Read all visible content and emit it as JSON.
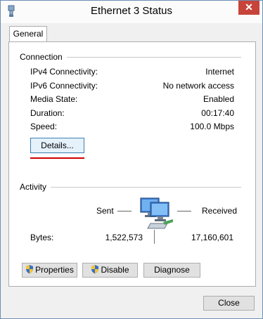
{
  "window": {
    "title": "Ethernet 3 Status"
  },
  "tabs": [
    {
      "label": "General"
    }
  ],
  "connection": {
    "group_label": "Connection",
    "rows": [
      {
        "label": "IPv4 Connectivity:",
        "value": "Internet"
      },
      {
        "label": "IPv6 Connectivity:",
        "value": "No network access"
      },
      {
        "label": "Media State:",
        "value": "Enabled"
      },
      {
        "label": "Duration:",
        "value": "00:17:40"
      },
      {
        "label": "Speed:",
        "value": "100.0 Mbps"
      }
    ],
    "details_label": "Details..."
  },
  "activity": {
    "group_label": "Activity",
    "sent_label": "Sent",
    "received_label": "Received",
    "bytes_label": "Bytes:",
    "bytes_sent": "1,522,573",
    "bytes_received": "17,160,601"
  },
  "buttons": {
    "properties": "Properties",
    "disable": "Disable",
    "diagnose": "Diagnose",
    "close": "Close"
  },
  "icons": {
    "title": "network-adapter-icon",
    "close": "close-icon",
    "properties": "shield-icon",
    "disable": "shield-icon",
    "activity": "network-computers-icon"
  },
  "colors": {
    "close_button": "#c7443b",
    "highlight_underline": "#d00000",
    "window_border": "#6b8eb6"
  }
}
